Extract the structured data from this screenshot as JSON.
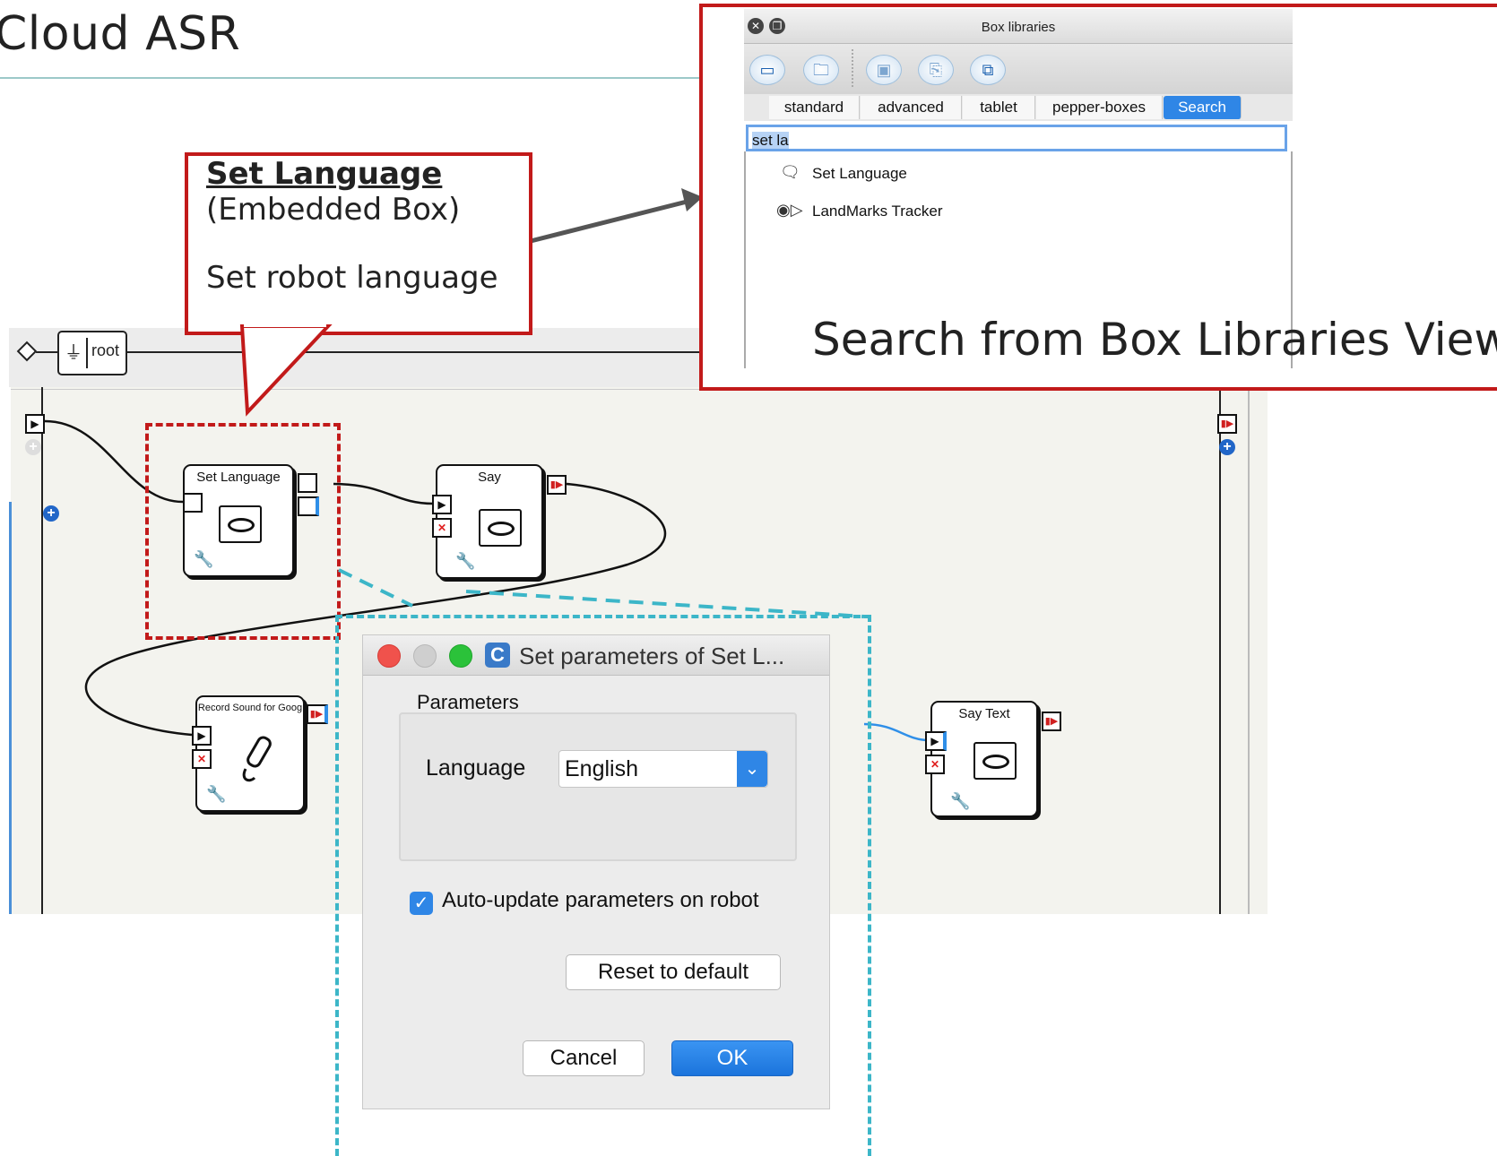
{
  "slide": {
    "title": "Cloud ASR"
  },
  "callout": {
    "title": "Set Language",
    "subtitle": "(Embedded Box)",
    "description": "Set robot language"
  },
  "library": {
    "window_title": "Box libraries",
    "tabs": [
      "standard",
      "advanced",
      "tablet",
      "pepper-boxes",
      "Search"
    ],
    "active_tab": "Search",
    "search_value": "set la",
    "results": [
      {
        "label": "Set Language",
        "icon": "speech-bubble-icon"
      },
      {
        "label": "LandMarks Tracker",
        "icon": "landmark-icon"
      }
    ],
    "caption": "Search from Box Libraries View",
    "toolbar_icons": [
      "new-window-icon",
      "open-folder-icon",
      "save-icon",
      "export-icon",
      "duplicate-icon"
    ]
  },
  "canvas": {
    "root_label": "root",
    "boxes": {
      "set_language": "Set Language",
      "say": "Say",
      "record": "Record Sound for Goog",
      "say_text": "Say Text"
    }
  },
  "dialog": {
    "title": "Set parameters of Set L...",
    "group_label": "Parameters",
    "language_label": "Language",
    "language_value": "English",
    "auto_update_label": "Auto-update parameters on robot",
    "auto_update_checked": true,
    "reset_label": "Reset to default",
    "cancel_label": "Cancel",
    "ok_label": "OK"
  },
  "colors": {
    "callout_border": "#c21a1a",
    "selection_dash": "#3cb6c8",
    "accent": "#2f86e6"
  }
}
